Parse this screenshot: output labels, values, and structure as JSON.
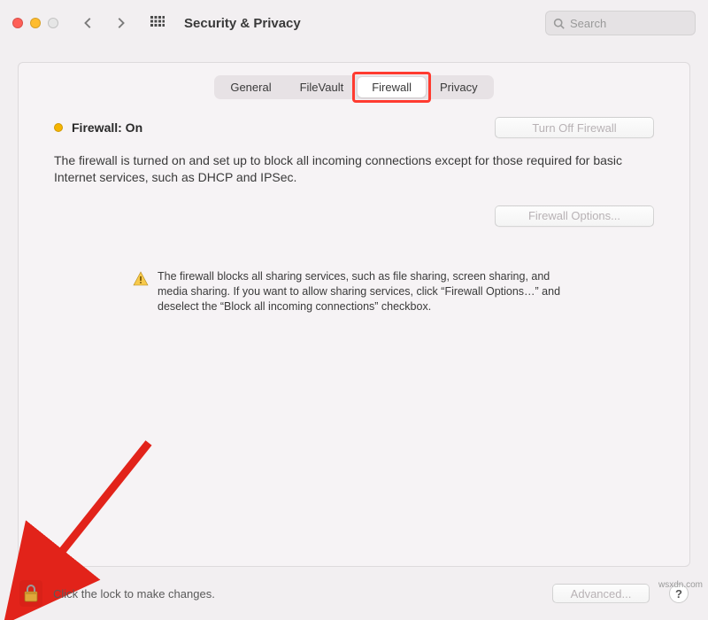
{
  "header": {
    "title": "Security & Privacy",
    "search_placeholder": "Search"
  },
  "tabs": {
    "items": [
      {
        "label": "General"
      },
      {
        "label": "FileVault"
      },
      {
        "label": "Firewall",
        "active": true
      },
      {
        "label": "Privacy"
      }
    ]
  },
  "firewall": {
    "status_label": "Firewall: On",
    "turn_off_label": "Turn Off Firewall",
    "description": "The firewall is turned on and set up to block all incoming connections except for those required for basic Internet services, such as DHCP and IPSec.",
    "options_label": "Firewall Options...",
    "warning_text": "The firewall blocks all sharing services, such as file sharing, screen sharing, and media sharing. If you want to allow sharing services, click “Firewall Options…” and deselect the “Block all incoming connections” checkbox."
  },
  "footer": {
    "lock_text": "Click the lock to make changes.",
    "advanced_label": "Advanced...",
    "help_label": "?"
  },
  "watermark": "wsxdn.com",
  "colors": {
    "highlight": "#ff3b30",
    "status_dot": "#f5b400"
  }
}
